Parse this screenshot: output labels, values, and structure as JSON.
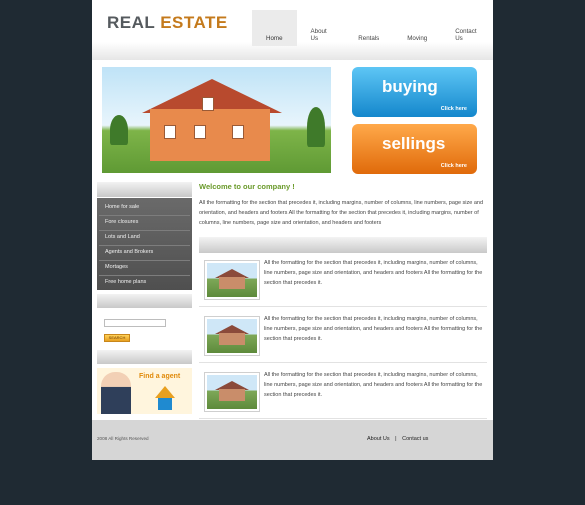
{
  "logo": {
    "part1": "REAL",
    "part2": " ESTATE"
  },
  "nav": [
    {
      "label": "Home"
    },
    {
      "label": "About Us"
    },
    {
      "label": "Rentals"
    },
    {
      "label": "Moving"
    },
    {
      "label": "Contact Us"
    }
  ],
  "cards": {
    "buy": {
      "title": "buying",
      "link": "Click here"
    },
    "sell": {
      "title": "sellings",
      "link": "Click here"
    }
  },
  "sidebar": {
    "items": [
      {
        "label": "Home for sale"
      },
      {
        "label": "Fore closures"
      },
      {
        "label": "Lots and Land"
      },
      {
        "label": "Agents and Brokers"
      },
      {
        "label": "Mortages"
      },
      {
        "label": "Free home plans"
      }
    ],
    "search_button": "SEARCH",
    "find_agent": "Find a agent"
  },
  "main": {
    "welcome": "Welcome to our company !",
    "intro": "All the formatting for the section that precedes it, including margins, number of columns, line numbers, page size and orientation, and headers and footers All the formatting for the section that precedes it, including margins, number of columns, line numbers, page size and orientation, and headers and footers",
    "listings": [
      {
        "text": "All the formatting for the section that precedes it, including margins, number of columns, line numbers, page size and orientation, and headers and footers All the formatting for the section that precedes it."
      },
      {
        "text": "All the formatting for the section that precedes it, including margins, number of columns, line numbers, page size and orientation, and headers and footers All the formatting for the section that precedes it."
      },
      {
        "text": "All the formatting for the section that precedes it, including margins, number of columns, line numbers, page size and orientation, and headers and footers All the formatting for the section that precedes it."
      }
    ]
  },
  "footer": {
    "copyright": "2008 All Rights Reserved",
    "about": "About Us",
    "sep": "|",
    "contact": "Contact us"
  },
  "colors": {
    "accent": "#c47a1c",
    "welcome": "#6a9a2a",
    "background": "#1f2a33"
  }
}
